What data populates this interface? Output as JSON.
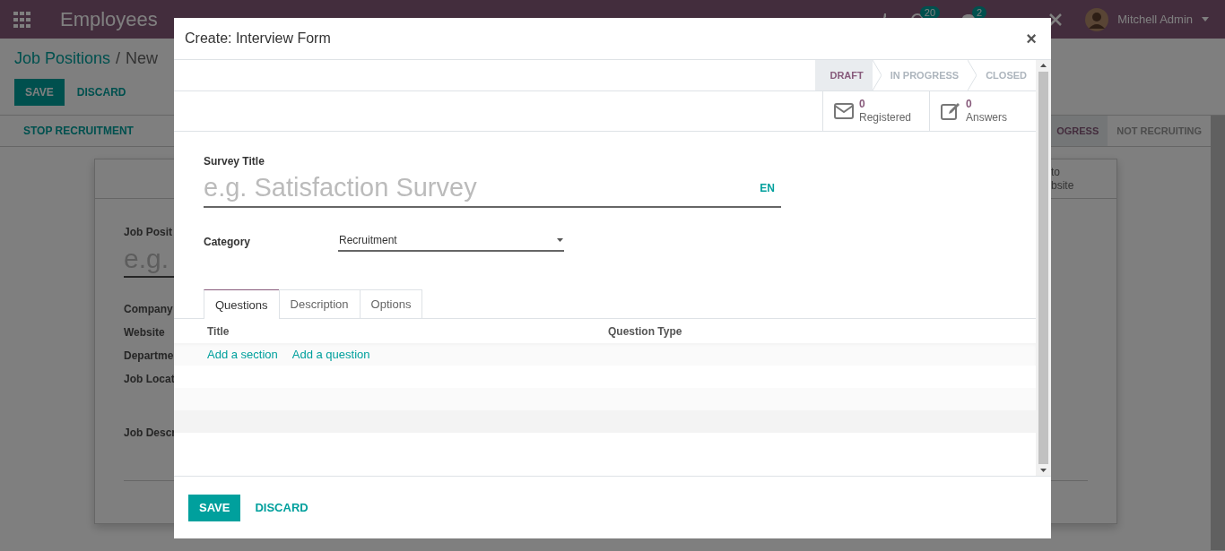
{
  "navbar": {
    "app_name": "Employees",
    "activity_count": "20",
    "message_count": "2",
    "user": "Mitchell Admin"
  },
  "breadcrumb": {
    "parent": "Job Positions",
    "separator": "/",
    "current": "New"
  },
  "buttons": [
    {
      "label": "SAVE",
      "kind": "primary"
    },
    {
      "label": "DISCARD",
      "kind": "link"
    }
  ],
  "header_button": "STOP RECRUITMENT",
  "stages": [
    {
      "label": "OGRESS",
      "selected": true
    },
    {
      "label": "NOT RECRUITING",
      "selected": false
    }
  ],
  "sheet": {
    "smart_button_lines": [
      "to",
      "bsite"
    ],
    "title_label": "Job Posit",
    "title_placeholder": "e.g.",
    "fields": [
      "Company",
      "Website",
      "Departme",
      "Job Locat"
    ],
    "description_label": "Job Descr"
  },
  "dialog": {
    "title": "Create: Interview Form",
    "close": "×",
    "stages": [
      {
        "label": "DRAFT",
        "selected": true
      },
      {
        "label": "IN PROGRESS",
        "selected": false
      },
      {
        "label": "CLOSED",
        "selected": false
      }
    ],
    "stat_buttons": [
      {
        "kind": "mail",
        "value": "0",
        "label": "Registered"
      },
      {
        "kind": "edit",
        "value": "0",
        "label": "Answers"
      }
    ],
    "survey_title": {
      "label": "Survey Title",
      "placeholder": "e.g. Satisfaction Survey",
      "language": "EN"
    },
    "category": {
      "label": "Category",
      "value": "Recruitment"
    },
    "tabs": [
      {
        "label": "Questions",
        "selected": true
      },
      {
        "label": "Description",
        "selected": false
      },
      {
        "label": "Options",
        "selected": false
      }
    ],
    "columns": [
      "Title",
      "Question Type"
    ],
    "add_links": [
      "Add a section",
      "Add a question"
    ],
    "buttons": [
      {
        "label": "SAVE",
        "kind": "primary"
      },
      {
        "label": "DISCARD",
        "kind": "link"
      }
    ]
  }
}
